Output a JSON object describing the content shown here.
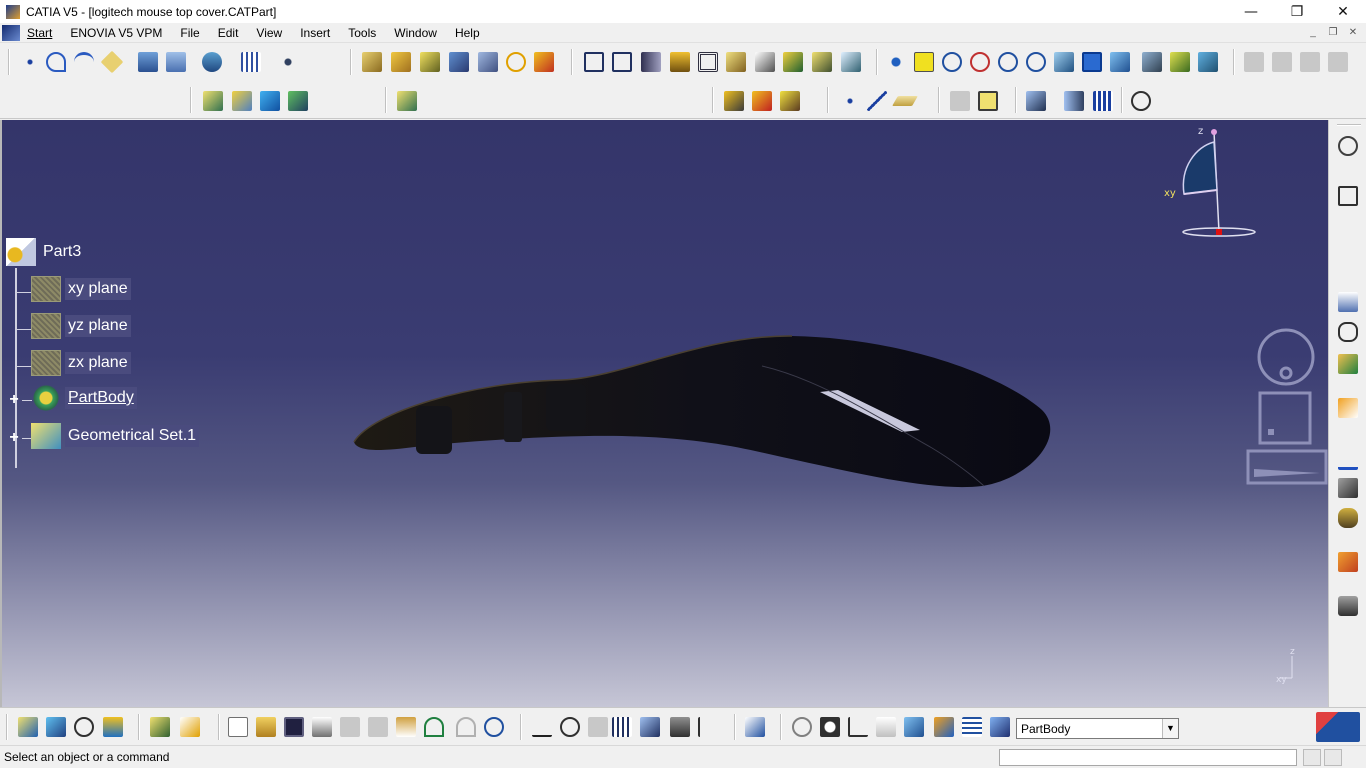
{
  "window": {
    "title": "CATIA V5 - [logitech mouse top cover.CATPart]",
    "controls": {
      "minimize": "—",
      "maximize": "❐",
      "close": "✕"
    }
  },
  "menu": {
    "items": [
      "Start",
      "ENOVIA V5 VPM",
      "File",
      "Edit",
      "View",
      "Insert",
      "Tools",
      "Window",
      "Help"
    ],
    "mdi": {
      "minimize": "_",
      "restore": "❐",
      "close": "✕"
    }
  },
  "tree": {
    "root": "Part3",
    "children": [
      {
        "label": "xy plane"
      },
      {
        "label": "yz plane"
      },
      {
        "label": "zx plane"
      },
      {
        "label": "PartBody"
      },
      {
        "label": "Geometrical Set.1"
      }
    ]
  },
  "compass": {
    "axis_z": "z",
    "axis_xy": "xy"
  },
  "mini_axis": {
    "z": "z",
    "xy": "xy"
  },
  "bottom": {
    "current_body": "PartBody"
  },
  "status": {
    "message": "Select an object or a command"
  },
  "colors": {
    "viewport_top": "#34356a",
    "viewport_bottom": "#c6c6d6",
    "part_fill": "#141420",
    "tree_text": "#ffffff"
  }
}
